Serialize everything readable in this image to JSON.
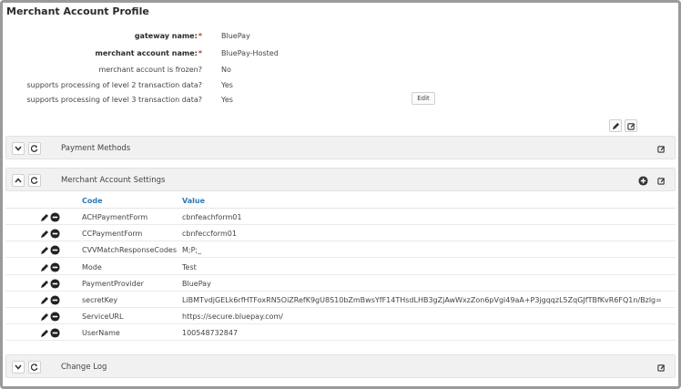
{
  "page": {
    "title": "Merchant Account Profile"
  },
  "profile": {
    "fields": [
      {
        "label": "gateway name:",
        "value": "BluePay",
        "required": true,
        "bold": true
      },
      {
        "label": "merchant account name:",
        "value": "BluePay-Hosted",
        "required": true,
        "bold": true
      },
      {
        "label": "merchant account is frozen?",
        "value": "No",
        "required": false,
        "bold": false
      },
      {
        "label": "supports processing of level 2 transaction data?",
        "value": "Yes",
        "required": false,
        "bold": false
      },
      {
        "label": "supports processing of level 3 transaction data?",
        "value": "Yes",
        "required": false,
        "bold": false
      }
    ],
    "required_mark": "*",
    "edit_label": "Edit"
  },
  "panels": {
    "payment_methods": {
      "title": "Payment Methods"
    },
    "settings": {
      "title": "Merchant Account Settings"
    },
    "change_log": {
      "title": "Change Log"
    }
  },
  "settings_table": {
    "headers": {
      "code": "Code",
      "value": "Value"
    },
    "rows": [
      {
        "code": "ACHPaymentForm",
        "value": "cbnfeachform01"
      },
      {
        "code": "CCPaymentForm",
        "value": "cbnfeccform01"
      },
      {
        "code": "CVVMatchResponseCodes",
        "value": "M;P;_"
      },
      {
        "code": "Mode",
        "value": "Test"
      },
      {
        "code": "PaymentProvider",
        "value": "BluePay"
      },
      {
        "code": "secretKey",
        "value": "LiBMTvdjGELk6rfHTFoxRN5OiZRefK9gU8S10bZmBwsYfF14THsdLHB3gZjAwWxzZon6pVgi49aA+P3jgqqzL5ZqGJfTBfKvR6FQ1n/Bzlg="
      },
      {
        "code": "ServiceURL",
        "value": "https://secure.bluepay.com/"
      },
      {
        "code": "UserName",
        "value": "100548732847"
      }
    ]
  },
  "colors": {
    "accent": "#2a7ab8",
    "required": "#c0392b",
    "bar": "#f1f1f1"
  },
  "icons": [
    "pencil-icon",
    "edit-note-icon",
    "chevron-down-icon",
    "chevron-up-icon",
    "refresh-icon",
    "plus-circle-icon",
    "minus-circle-icon"
  ]
}
